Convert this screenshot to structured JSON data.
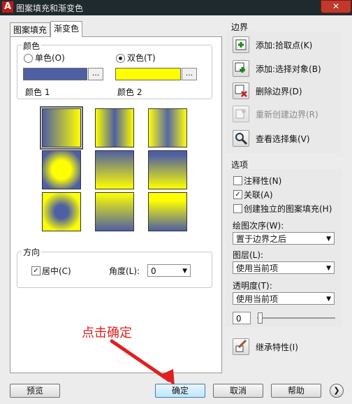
{
  "window": {
    "title": "图案填充和渐变色",
    "close_label": "✕"
  },
  "tabs": [
    {
      "label": "图案填充"
    },
    {
      "label": "渐变色"
    }
  ],
  "colors": {
    "group_label": "颜色",
    "single_label": "单色(O)",
    "double_label": "双色(T)",
    "color1_label": "颜色 1",
    "color2_label": "颜色 2",
    "color1_hex": "#4e5fa3",
    "color2_hex": "#ffff00",
    "browse": "..."
  },
  "direction": {
    "group_label": "方向",
    "centered_label": "居中(C)",
    "angle_label": "角度(L):",
    "angle_value": "0"
  },
  "boundary": {
    "label": "边界",
    "add_pick": "添加:拾取点(K)",
    "add_select": "添加:选择对象(B)",
    "remove": "删除边界(D)",
    "recreate": "重新创建边界(R)",
    "view": "查看选择集(V)"
  },
  "options": {
    "label": "选项",
    "annotative": "注释性(N)",
    "associative": "关联(A)",
    "separate": "创建独立的图案填充(H)",
    "draw_order_label": "绘图次序(W):",
    "draw_order_value": "置于边界之后",
    "layer_label": "图层(L):",
    "layer_value": "使用当前项",
    "transparency_label": "透明度(T):",
    "transparency_value": "使用当前项",
    "transparency_number": "0"
  },
  "inherit_label": "继承特性(I)",
  "buttons": {
    "preview": "预览",
    "ok": "确定",
    "cancel": "取消",
    "help": "帮助"
  },
  "annotation": "点击确定"
}
